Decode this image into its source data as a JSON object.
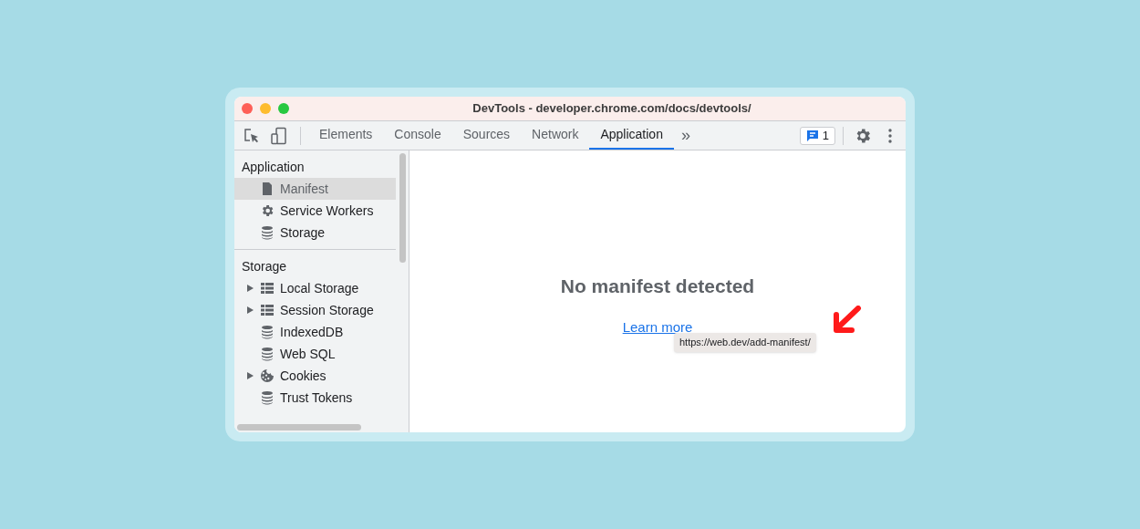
{
  "window": {
    "title": "DevTools - developer.chrome.com/docs/devtools/"
  },
  "tabs": [
    {
      "label": "Elements",
      "selected": false
    },
    {
      "label": "Console",
      "selected": false
    },
    {
      "label": "Sources",
      "selected": false
    },
    {
      "label": "Network",
      "selected": false
    },
    {
      "label": "Application",
      "selected": true
    }
  ],
  "more_tabs": "»",
  "issues_badge": {
    "count": "1"
  },
  "sidebar": {
    "sections": [
      {
        "title": "Application",
        "items": [
          {
            "label": "Manifest",
            "kind": "file",
            "selected": true
          },
          {
            "label": "Service Workers",
            "kind": "gear",
            "selected": false
          },
          {
            "label": "Storage",
            "kind": "database",
            "selected": false
          }
        ]
      },
      {
        "title": "Storage",
        "items": [
          {
            "label": "Local Storage",
            "kind": "grid",
            "selected": false,
            "expanded": false
          },
          {
            "label": "Session Storage",
            "kind": "grid",
            "selected": false,
            "expanded": false
          },
          {
            "label": "IndexedDB",
            "kind": "database",
            "selected": false
          },
          {
            "label": "Web SQL",
            "kind": "database",
            "selected": false
          },
          {
            "label": "Cookies",
            "kind": "cookie",
            "selected": false,
            "expanded": false
          },
          {
            "label": "Trust Tokens",
            "kind": "database",
            "selected": false
          }
        ]
      }
    ]
  },
  "main": {
    "heading": "No manifest detected",
    "link": "Learn more",
    "tooltip": "https://web.dev/add-manifest/"
  }
}
